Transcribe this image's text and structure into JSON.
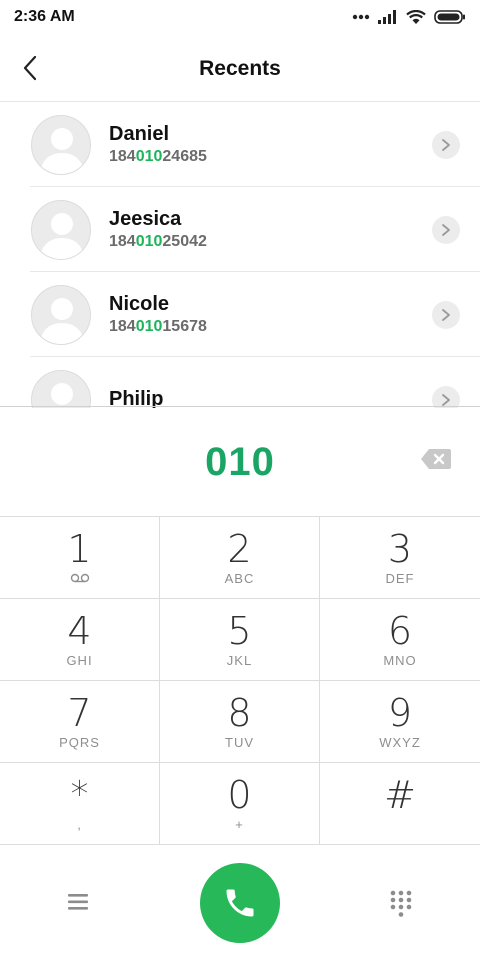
{
  "status_bar": {
    "time": "2:36 AM",
    "icons": [
      "more-dots-icon",
      "signal-icon",
      "wifi-icon",
      "battery-icon"
    ]
  },
  "header": {
    "title": "Recents",
    "back_icon": "back-chevron-icon"
  },
  "recents": [
    {
      "name": "Daniel",
      "number_prefix": "184",
      "number_match": "010",
      "number_suffix": "24685"
    },
    {
      "name": "Jeesica",
      "number_prefix": "184",
      "number_match": "010",
      "number_suffix": "25042"
    },
    {
      "name": "Nicole",
      "number_prefix": "184",
      "number_match": "010",
      "number_suffix": "15678"
    },
    {
      "name": "Philip",
      "number_prefix": "",
      "number_match": "",
      "number_suffix": ""
    }
  ],
  "dialer": {
    "dialed_number": "010",
    "backspace_icon": "backspace-icon"
  },
  "keypad": [
    {
      "digit": "1",
      "letters": "",
      "icon": "voicemail-icon"
    },
    {
      "digit": "2",
      "letters": "ABC"
    },
    {
      "digit": "3",
      "letters": "DEF"
    },
    {
      "digit": "4",
      "letters": "GHI"
    },
    {
      "digit": "5",
      "letters": "JKL"
    },
    {
      "digit": "6",
      "letters": "MNO"
    },
    {
      "digit": "7",
      "letters": "PQRS"
    },
    {
      "digit": "8",
      "letters": "TUV"
    },
    {
      "digit": "9",
      "letters": "WXYZ"
    },
    {
      "digit": "*",
      "letters": ","
    },
    {
      "digit": "0",
      "letters": "+"
    },
    {
      "digit": "#",
      "letters": ""
    }
  ],
  "bottom_bar": {
    "menu_icon": "menu-icon",
    "call_icon": "phone-icon",
    "keypad_icon": "dialpad-icon"
  },
  "colors": {
    "accent_green": "#1aa565",
    "call_button": "#27b85a",
    "match_highlight": "#1db45a"
  }
}
